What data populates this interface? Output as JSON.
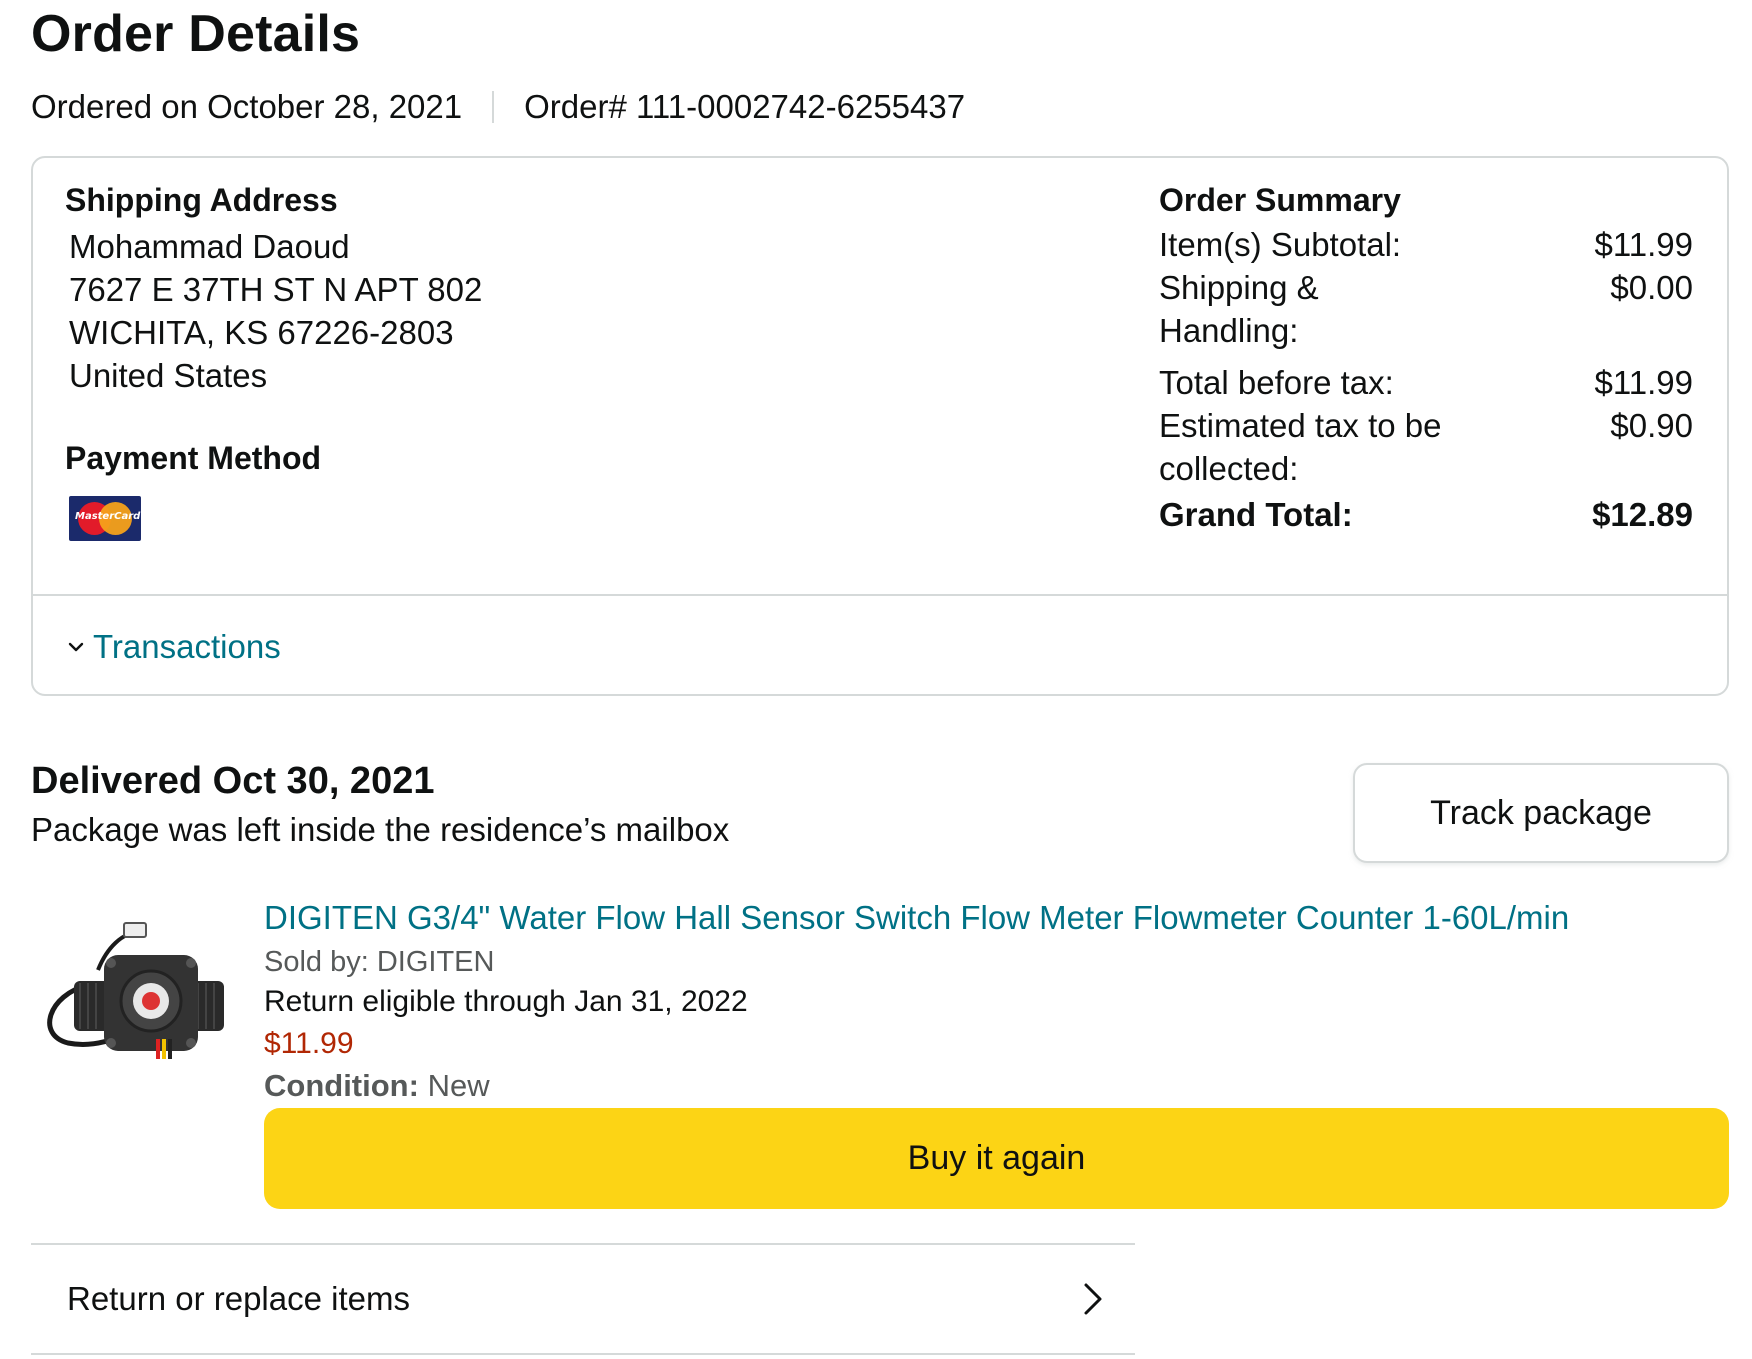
{
  "page": {
    "title": "Order Details",
    "ordered_on": "Ordered on October 28, 2021",
    "order_number": "Order# 111-0002742-6255437"
  },
  "shipping": {
    "heading": "Shipping Address",
    "lines": [
      "Mohammad Daoud",
      "7627 E 37TH ST N APT 802",
      "WICHITA, KS 67226-2803",
      "United States"
    ]
  },
  "payment": {
    "heading": "Payment Method",
    "card_icon": "mastercard-icon",
    "card_logo_text": "MasterCard"
  },
  "summary": {
    "heading": "Order Summary",
    "rows": [
      {
        "label": "Item(s) Subtotal:",
        "value": "$11.99"
      },
      {
        "label": "Shipping & Handling:",
        "value": "$0.00"
      },
      {
        "label": "Total before tax:",
        "value": "$11.99"
      },
      {
        "label": "Estimated tax to be collected:",
        "value": "$0.90"
      }
    ],
    "grand_total_label": "Grand Total:",
    "grand_total_value": "$12.89"
  },
  "transactions": {
    "label": "Transactions",
    "icon": "chevron-down-icon"
  },
  "shipment": {
    "status": "Delivered Oct 30, 2021",
    "detail": "Package was left inside the residence’s mailbox",
    "track_label": "Track package"
  },
  "item": {
    "title": "DIGITEN G3/4\" Water Flow Hall Sensor Switch Flow Meter Flowmeter Counter 1-60L/min",
    "sold_by": "Sold by: DIGITEN",
    "return_eligible": "Return eligible through Jan 31, 2022",
    "price": "$11.99",
    "condition_label": "Condition:",
    "condition_value": "New",
    "buy_again_label": "Buy it again",
    "image_icon": "flow-sensor-product-image"
  },
  "actions": {
    "return_label": "Return or replace items",
    "icon": "chevron-right-icon"
  },
  "colors": {
    "link": "#007185",
    "price": "#b12704",
    "buy_button": "#fcd415",
    "border": "#d5d9d9"
  }
}
